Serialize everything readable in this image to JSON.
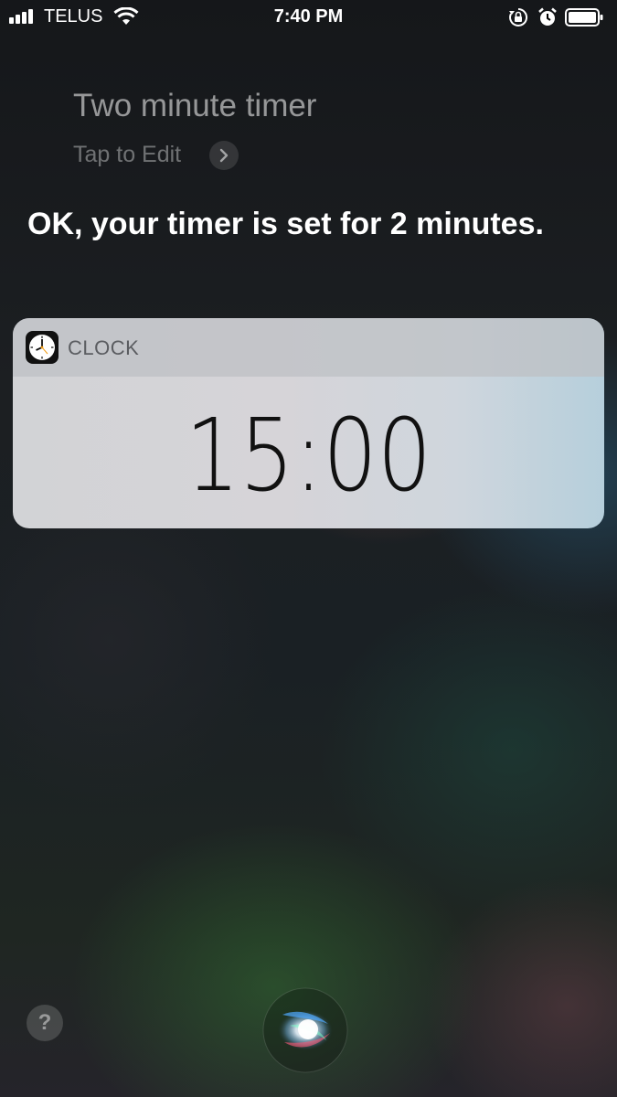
{
  "status_bar": {
    "carrier": "TELUS",
    "time": "7:40 PM",
    "icons": [
      "signal-bars-icon",
      "wifi-icon",
      "rotation-lock-icon",
      "alarm-icon",
      "battery-icon"
    ]
  },
  "siri": {
    "query": "Two minute timer",
    "tap_to_edit": "Tap to Edit",
    "response": "OK, your timer is set for 2 minutes."
  },
  "card": {
    "app_name": "CLOCK",
    "app_icon": "clock-app-icon",
    "timer_value": "15:00"
  },
  "bottom": {
    "help_label": "?",
    "orb_icon": "siri-orb-icon"
  },
  "colors": {
    "card_background": "#d2d3d6",
    "card_header": "#bec0c4",
    "text_primary": "#ffffff",
    "timer_text": "#111111"
  }
}
